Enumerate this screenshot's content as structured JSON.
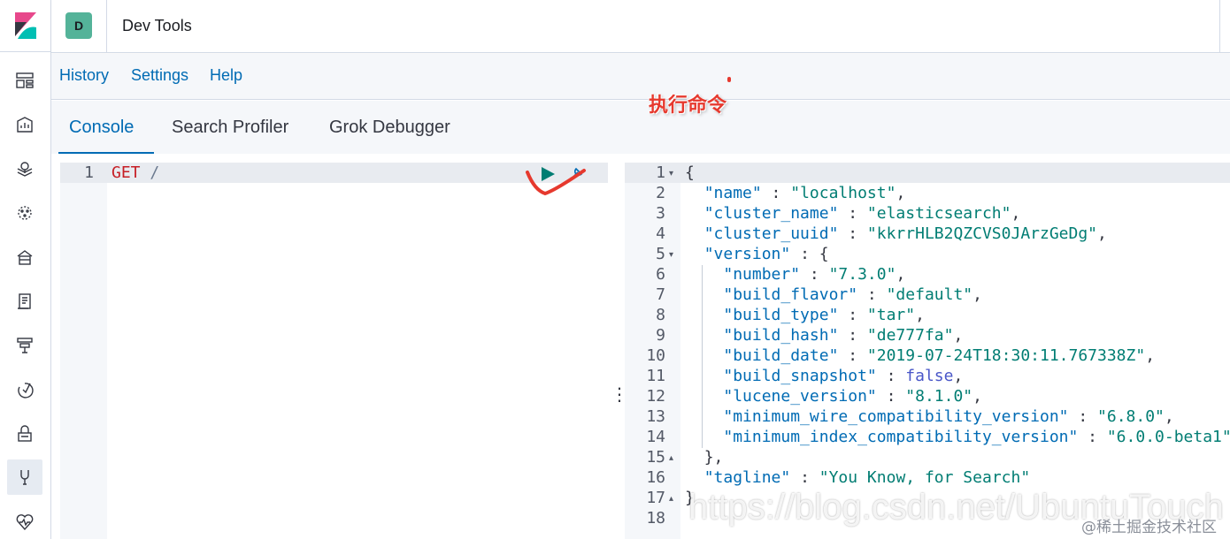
{
  "header": {
    "space_initial": "D",
    "title": "Dev Tools"
  },
  "topnav": {
    "history": "History",
    "settings": "Settings",
    "help": "Help"
  },
  "tabs": [
    {
      "label": "Console",
      "selected": true
    },
    {
      "label": "Search Profiler",
      "selected": false
    },
    {
      "label": "Grok Debugger",
      "selected": false
    }
  ],
  "request": {
    "line_number": "1",
    "method": "GET",
    "path": "/"
  },
  "response": {
    "line_numbers": [
      "1",
      "2",
      "3",
      "4",
      "5",
      "6",
      "7",
      "8",
      "9",
      "10",
      "11",
      "12",
      "13",
      "14",
      "15",
      "16",
      "17",
      "18"
    ],
    "lines": {
      "l1": "{",
      "name_key": "\"name\"",
      "name_val": "\"localhost\"",
      "cluster_name_key": "\"cluster_name\"",
      "cluster_name_val": "\"elasticsearch\"",
      "cluster_uuid_key": "\"cluster_uuid\"",
      "cluster_uuid_val": "\"kkrrHLB2QZCVS0JArzGeDg\"",
      "version_key": "\"version\"",
      "number_key": "\"number\"",
      "number_val": "\"7.3.0\"",
      "build_flavor_key": "\"build_flavor\"",
      "build_flavor_val": "\"default\"",
      "build_type_key": "\"build_type\"",
      "build_type_val": "\"tar\"",
      "build_hash_key": "\"build_hash\"",
      "build_hash_val": "\"de777fa\"",
      "build_date_key": "\"build_date\"",
      "build_date_val": "\"2019-07-24T18:30:11.767338Z\"",
      "build_snapshot_key": "\"build_snapshot\"",
      "build_snapshot_val": "false",
      "lucene_version_key": "\"lucene_version\"",
      "lucene_version_val": "\"8.1.0\"",
      "min_wire_key": "\"minimum_wire_compatibility_version\"",
      "min_wire_val": "\"6.8.0\"",
      "min_index_key": "\"minimum_index_compatibility_version\"",
      "min_index_val": "\"6.0.0-beta1\"",
      "l15": "},",
      "tagline_key": "\"tagline\"",
      "tagline_val": "\"You Know, for Search\"",
      "l17": "}"
    }
  },
  "annotation": {
    "text": "执行命令"
  },
  "watermarks": {
    "url": "https://blog.csdn.net/UbuntuTouch",
    "site": "@稀土掘金技术社区"
  },
  "nav_icons": [
    "kibana-logo-icon",
    "dashboard-icon",
    "canvas-icon",
    "maps-icon",
    "ml-icon",
    "infrastructure-icon",
    "logs-icon",
    "apm-icon",
    "uptime-icon",
    "siem-icon",
    "dev-tools-icon",
    "monitoring-icon"
  ],
  "colors": {
    "link": "#006bb4",
    "annotation": "#e6392e",
    "string": "#017d73",
    "key": "#006bb4"
  }
}
